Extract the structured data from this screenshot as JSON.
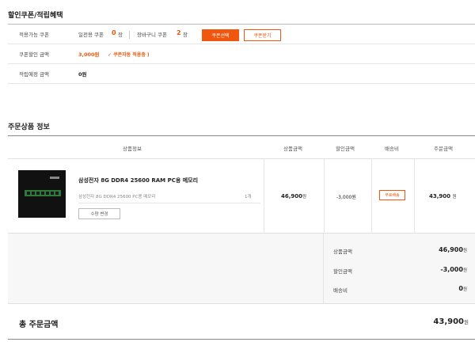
{
  "coupon_section": {
    "title": "할인쿠폰/적립혜택",
    "rows": {
      "available": {
        "label": "적용가능 쿠폰",
        "store_coupon_label": "일전용 쿠폰",
        "store_coupon_count": "0",
        "store_coupon_unit": "장",
        "cart_coupon_label": "장바구니 쿠폰",
        "cart_coupon_count": "2",
        "cart_coupon_unit": "장",
        "select_button": "쿠폰선택",
        "receive_button": "쿠폰받기"
      },
      "discount": {
        "label": "쿠폰할인 금액",
        "amount": "3,000원",
        "note": "✓ 쿠폰자동 적용중 )"
      },
      "points": {
        "label": "적립예정 금액",
        "amount": "0원"
      }
    }
  },
  "order_section": {
    "title": "주문상품 정보",
    "headers": {
      "product": "상품정보",
      "price": "상품금액",
      "discount": "할인금액",
      "shipping": "배송비",
      "order_amount": "주문금액"
    },
    "product": {
      "name": "삼성전자 8G DDR4 25600 RAM PC용 메모리",
      "option": "삼성전자 8G DDR4 25600 PC용 메모리",
      "qty": "1개",
      "change_qty_button": "수량 변경",
      "price": "46,900",
      "discount": "-3,000원",
      "shipping_badge": "무료배송",
      "order_amount": "43,900",
      "currency": "원"
    }
  },
  "summary": {
    "product_amount_label": "상품금액",
    "product_amount": "46,900",
    "discount_label": "할인금액",
    "discount_amount": "-3,000",
    "shipping_label": "배송비",
    "shipping_amount": "0",
    "currency": "원"
  },
  "total": {
    "label": "총 주문금액",
    "amount": "43,900",
    "currency": "원"
  },
  "colors": {
    "accent": "#f0560e",
    "accent_text": "#e8590c"
  }
}
